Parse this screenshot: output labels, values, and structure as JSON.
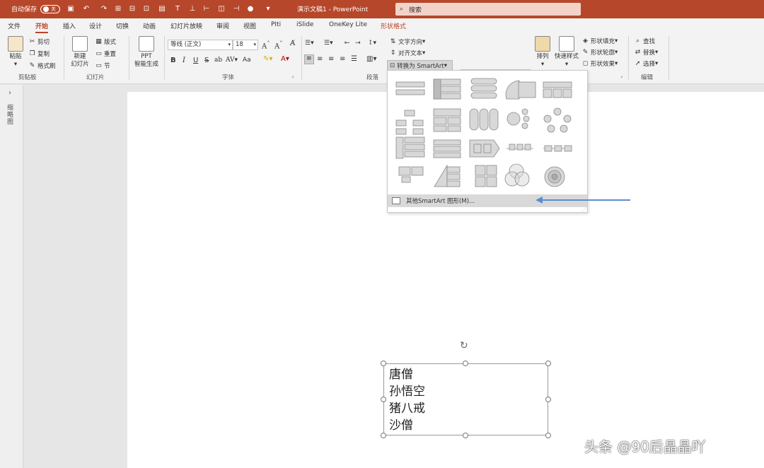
{
  "titlebar": {
    "autosave_label": "自动保存",
    "autosave_state": "关",
    "doc_title": "演示文稿1 - PowerPoint",
    "search_placeholder": "搜索",
    "color": "#b7472a"
  },
  "tabs": [
    "文件",
    "开始",
    "插入",
    "设计",
    "切换",
    "动画",
    "幻灯片放映",
    "审阅",
    "视图",
    "PIti",
    "iSlide",
    "OneKey Lite",
    "形状格式"
  ],
  "active_tab": "开始",
  "ribbon": {
    "clipboard": {
      "paste": "粘贴",
      "cut": "剪切",
      "copy": "复制",
      "format_painter": "格式刷",
      "group": "剪贴板"
    },
    "slides": {
      "new_slide": "新建",
      "new_slide2": "幻灯片",
      "layout": "版式",
      "reset": "重置",
      "section": "节",
      "group": "幻灯片"
    },
    "ppt": {
      "line1": "PPT",
      "line2": "智能生成"
    },
    "font": {
      "name": "等线 (正文)",
      "size": "18",
      "group": "字体",
      "bold": "B",
      "italic": "I",
      "underline": "U",
      "strike": "S",
      "shadow": "ab",
      "case": "Aa"
    },
    "paragraph": {
      "text_direction": "文字方向",
      "align_text": "对齐文本",
      "convert_smartart": "转换为 SmartArt",
      "group": "段落"
    },
    "drawing": {
      "arrange": "排列",
      "quick_styles": "快速样式",
      "fill": "形状填充",
      "outline": "形状轮廓",
      "effects": "形状效果"
    },
    "editing": {
      "find": "查找",
      "replace": "替换",
      "select": "选择",
      "group": "编辑"
    }
  },
  "left_pane": {
    "label": "缩略图"
  },
  "smartart_menu": {
    "more_label": "其他SmartArt 图形(M)..."
  },
  "textbox": {
    "lines": [
      "唐僧",
      "孙悟空",
      "猪八戒",
      "沙僧"
    ]
  },
  "watermark": "头条 @90后晶晶吖"
}
